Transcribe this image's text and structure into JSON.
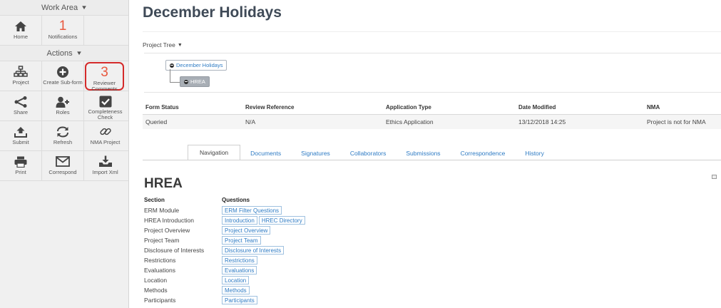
{
  "sidebar": {
    "work_area_label": "Work Area",
    "actions_label": "Actions",
    "home_label": "Home",
    "notifications_count": "1",
    "notifications_label": "Notifications",
    "project_label": "Project",
    "create_subform_label": "Create Sub-form",
    "reviewer_comments_count": "3",
    "reviewer_comments_label": "Reviewer Comments",
    "share_label": "Share",
    "roles_label": "Roles",
    "completeness_label": "Completeness Check",
    "submit_label": "Submit",
    "refresh_label": "Refresh",
    "nma_project_label": "NMA Project",
    "print_label": "Print",
    "correspond_label": "Correspond",
    "import_xml_label": "Import Xml"
  },
  "page": {
    "title": "December Holidays",
    "project_tree_label": "Project Tree",
    "tree_root": "December Holidays",
    "tree_child": "HREA"
  },
  "status_table": {
    "headers": [
      "Form Status",
      "Review Reference",
      "Application Type",
      "Date Modified",
      "NMA"
    ],
    "values": [
      "Queried",
      "N/A",
      "Ethics Application",
      "13/12/2018 14:25",
      "Project is not for NMA"
    ]
  },
  "tabs": [
    "Navigation",
    "Documents",
    "Signatures",
    "Collaborators",
    "Submissions",
    "Correspondence",
    "History"
  ],
  "hrea": {
    "title": "HREA",
    "section_header": "Section",
    "questions_header": "Questions",
    "rows": [
      {
        "section": "ERM Module",
        "links": [
          "ERM Filter Questions"
        ]
      },
      {
        "section": "HREA Introduction",
        "links": [
          "Introduction",
          "HREC Directory"
        ]
      },
      {
        "section": "Project Overview",
        "links": [
          "Project Overview"
        ]
      },
      {
        "section": "Project Team",
        "links": [
          "Project Team"
        ]
      },
      {
        "section": "Disclosure of Interests",
        "links": [
          "Disclosure of Interests"
        ]
      },
      {
        "section": "Restrictions",
        "links": [
          "Restrictions"
        ]
      },
      {
        "section": "Evaluations",
        "links": [
          "Evaluations"
        ]
      },
      {
        "section": "Location",
        "links": [
          "Location"
        ]
      },
      {
        "section": "Methods",
        "links": [
          "Methods"
        ]
      },
      {
        "section": "Participants",
        "links": [
          "Participants"
        ]
      }
    ]
  },
  "colors": {
    "accent": "#2e7bc4",
    "count": "#e8573d",
    "highlight": "#d42a2a"
  }
}
